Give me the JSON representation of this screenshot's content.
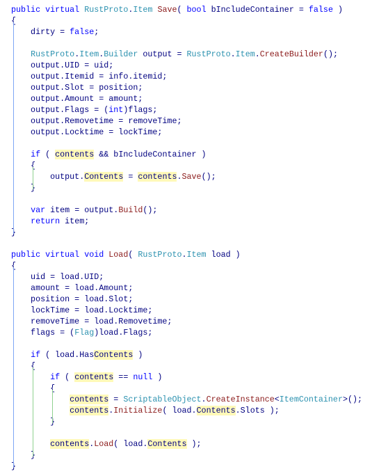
{
  "editor": {
    "colors": {
      "keyword": "#0000ff",
      "type": "#2b91af",
      "method": "#8b1a1a",
      "text": "#000080",
      "highlight": "#fff9b8"
    },
    "lines": [
      [
        [
          "public virtual ",
          "k"
        ],
        [
          "RustProto",
          "t"
        ],
        [
          ".",
          "p"
        ],
        [
          "Item",
          "t"
        ],
        [
          " ",
          "p"
        ],
        [
          "Save",
          "m"
        ],
        [
          "( ",
          "p"
        ],
        [
          "bool",
          "k"
        ],
        [
          " bIncludeContainer = ",
          "p"
        ],
        [
          "false",
          "k"
        ],
        [
          " )",
          "p"
        ]
      ],
      [
        [
          "{",
          "p"
        ]
      ],
      [
        [
          "    dirty = ",
          "p"
        ],
        [
          "false",
          "k"
        ],
        [
          ";",
          "p"
        ]
      ],
      [],
      [
        [
          "    ",
          "p"
        ],
        [
          "RustProto",
          "t"
        ],
        [
          ".",
          "p"
        ],
        [
          "Item",
          "t"
        ],
        [
          ".",
          "p"
        ],
        [
          "Builder",
          "t"
        ],
        [
          " output = ",
          "p"
        ],
        [
          "RustProto",
          "t"
        ],
        [
          ".",
          "p"
        ],
        [
          "Item",
          "t"
        ],
        [
          ".",
          "p"
        ],
        [
          "CreateBuilder",
          "m"
        ],
        [
          "();",
          "p"
        ]
      ],
      [
        [
          "    output.UID = uid;",
          "p"
        ]
      ],
      [
        [
          "    output.Itemid = info.itemid;",
          "p"
        ]
      ],
      [
        [
          "    output.Slot = position;",
          "p"
        ]
      ],
      [
        [
          "    output.Amount = amount;",
          "p"
        ]
      ],
      [
        [
          "    output.Flags = (",
          "p"
        ],
        [
          "int",
          "k"
        ],
        [
          ")flags;",
          "p"
        ]
      ],
      [
        [
          "    output.Removetime = removeTime;",
          "p"
        ]
      ],
      [
        [
          "    output.Locktime = lockTime;",
          "p"
        ]
      ],
      [],
      [
        [
          "    ",
          "p"
        ],
        [
          "if",
          "k"
        ],
        [
          " ( ",
          "p"
        ],
        [
          "contents",
          "h"
        ],
        [
          " && bIncludeContainer )",
          "p"
        ]
      ],
      [
        [
          "    {",
          "p"
        ]
      ],
      [
        [
          "        output.",
          "p"
        ],
        [
          "Contents",
          "h"
        ],
        [
          " = ",
          "p"
        ],
        [
          "contents",
          "h"
        ],
        [
          ".",
          "p"
        ],
        [
          "Save",
          "m"
        ],
        [
          "();",
          "p"
        ]
      ],
      [
        [
          "    }",
          "p"
        ]
      ],
      [],
      [
        [
          "    ",
          "p"
        ],
        [
          "var",
          "k"
        ],
        [
          " item = output.",
          "p"
        ],
        [
          "Build",
          "m"
        ],
        [
          "();",
          "p"
        ]
      ],
      [
        [
          "    ",
          "p"
        ],
        [
          "return",
          "k"
        ],
        [
          " item;",
          "p"
        ]
      ],
      [
        [
          "}",
          "p"
        ]
      ],
      [],
      [
        [
          "public virtual void ",
          "k"
        ],
        [
          "Load",
          "m"
        ],
        [
          "( ",
          "p"
        ],
        [
          "RustProto",
          "t"
        ],
        [
          ".",
          "p"
        ],
        [
          "Item",
          "t"
        ],
        [
          " load )",
          "p"
        ]
      ],
      [
        [
          "{",
          "p"
        ]
      ],
      [
        [
          "    uid = load.UID;",
          "p"
        ]
      ],
      [
        [
          "    amount = load.Amount;",
          "p"
        ]
      ],
      [
        [
          "    position = load.Slot;",
          "p"
        ]
      ],
      [
        [
          "    lockTime = load.Locktime;",
          "p"
        ]
      ],
      [
        [
          "    removeTime = load.Removetime;",
          "p"
        ]
      ],
      [
        [
          "    flags = (",
          "p"
        ],
        [
          "Flag",
          "t"
        ],
        [
          ")load.Flags;",
          "p"
        ]
      ],
      [],
      [
        [
          "    ",
          "p"
        ],
        [
          "if",
          "k"
        ],
        [
          " ( load.Has",
          "p"
        ],
        [
          "Contents",
          "h"
        ],
        [
          " )",
          "p"
        ]
      ],
      [
        [
          "    {",
          "p"
        ]
      ],
      [
        [
          "        ",
          "p"
        ],
        [
          "if",
          "k"
        ],
        [
          " ( ",
          "p"
        ],
        [
          "contents",
          "h"
        ],
        [
          " == ",
          "p"
        ],
        [
          "null",
          "k"
        ],
        [
          " )",
          "p"
        ]
      ],
      [
        [
          "        {",
          "p"
        ]
      ],
      [
        [
          "            ",
          "p"
        ],
        [
          "contents",
          "h"
        ],
        [
          " = ",
          "p"
        ],
        [
          "ScriptableObject",
          "t"
        ],
        [
          ".",
          "p"
        ],
        [
          "CreateInstance",
          "m"
        ],
        [
          "<",
          "p"
        ],
        [
          "ItemContainer",
          "t"
        ],
        [
          ">();",
          "p"
        ]
      ],
      [
        [
          "            ",
          "p"
        ],
        [
          "contents",
          "h"
        ],
        [
          ".",
          "p"
        ],
        [
          "Initialize",
          "m"
        ],
        [
          "( load.",
          "p"
        ],
        [
          "Contents",
          "h"
        ],
        [
          ".Slots );",
          "p"
        ]
      ],
      [
        [
          "        }",
          "p"
        ]
      ],
      [],
      [
        [
          "        ",
          "p"
        ],
        [
          "contents",
          "h"
        ],
        [
          ".",
          "p"
        ],
        [
          "Load",
          "m"
        ],
        [
          "( load.",
          "p"
        ],
        [
          "Contents",
          "h"
        ],
        [
          " );",
          "p"
        ]
      ],
      [
        [
          "    }",
          "p"
        ]
      ],
      [
        [
          "}",
          "p"
        ]
      ]
    ]
  }
}
